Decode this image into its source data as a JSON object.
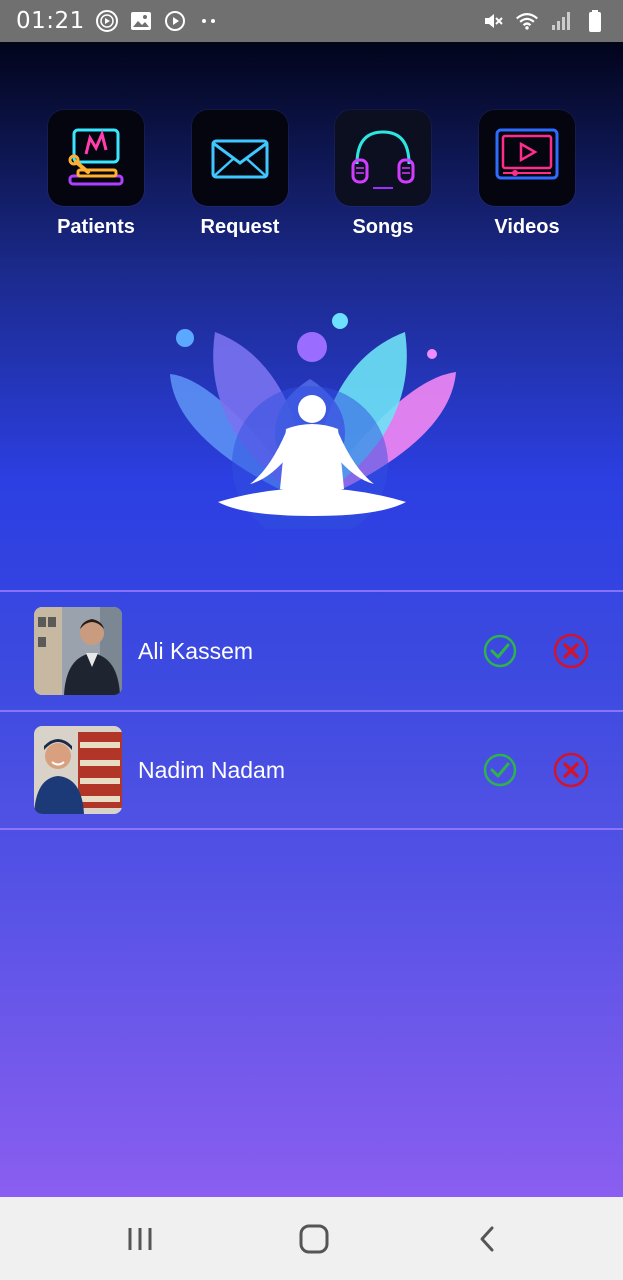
{
  "status_bar": {
    "time": "01:21",
    "left_icons": [
      "vpn-play-icon",
      "image-icon",
      "play-circle-icon",
      "more-dots-icon"
    ],
    "right_icons": [
      "mute-icon",
      "wifi-icon",
      "signal-icon",
      "battery-icon"
    ]
  },
  "menu": {
    "items": [
      {
        "label": "Patients",
        "icon": "patients-neon-icon"
      },
      {
        "label": "Request",
        "icon": "envelope-neon-icon"
      },
      {
        "label": "Songs",
        "icon": "headphones-neon-icon"
      },
      {
        "label": "Videos",
        "icon": "video-player-neon-icon"
      }
    ]
  },
  "logo": {
    "icon": "meditation-lotus-icon"
  },
  "requests": [
    {
      "name": "Ali Kassem",
      "accept_icon": "check-circle-icon",
      "reject_icon": "x-circle-icon"
    },
    {
      "name": "Nadim Nadam",
      "accept_icon": "check-circle-icon",
      "reject_icon": "x-circle-icon"
    }
  ],
  "nav_bar": {
    "buttons": [
      "recent-apps-icon",
      "home-icon",
      "back-icon"
    ]
  },
  "colors": {
    "accept": "#2fb24c",
    "reject": "#d0142c",
    "status_bar": "#707070",
    "nav_bar": "#f0f0f0"
  }
}
